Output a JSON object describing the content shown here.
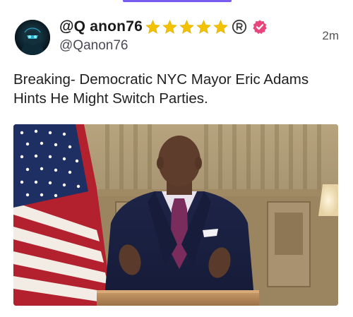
{
  "post": {
    "display_name": "@Q anon76",
    "handle": "@Qanon76",
    "timestamp": "2m",
    "text": "Breaking- Democratic NYC Mayor Eric Adams Hints He Might Switch Parties.",
    "badges": {
      "stars": [
        "star-icon",
        "star-icon",
        "star-icon",
        "star-icon",
        "star-icon"
      ],
      "registered": "registered-icon",
      "verified": "verified-badge-icon"
    },
    "avatar_icon": "avatar",
    "media_icon": "post-photo"
  },
  "colors": {
    "accent": "#7b5cf0",
    "star": "#f2c200",
    "verified": "#e8457a",
    "text": "#1f1f1f",
    "muted": "#555555"
  }
}
